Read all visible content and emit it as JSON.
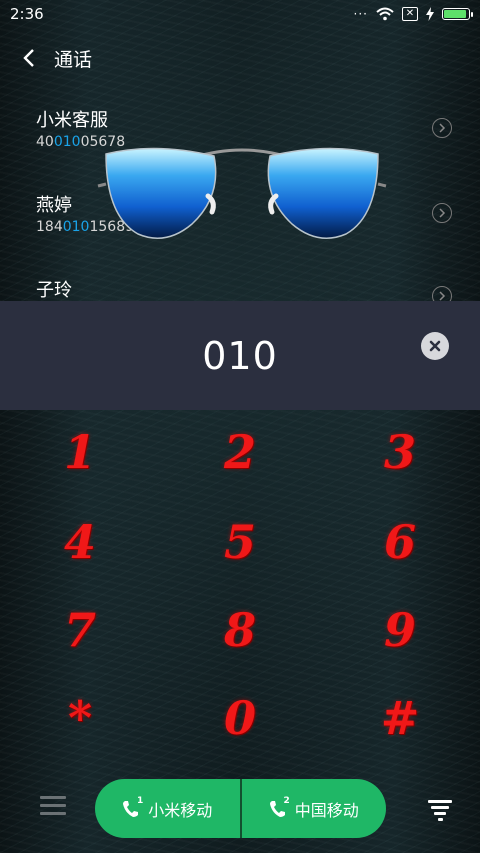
{
  "status": {
    "time": "2:36"
  },
  "header": {
    "title": "通话"
  },
  "contacts": [
    {
      "name": "小米客服",
      "num_pre": "40",
      "num_hl": "010",
      "num_post": "05678"
    },
    {
      "name": "燕婷",
      "num_pre": "184",
      "num_hl": "010",
      "num_post": "15689"
    },
    {
      "name": "子玲",
      "num_pre": "",
      "num_hl": "",
      "num_post": ""
    }
  ],
  "dial": {
    "value": "010"
  },
  "keys": [
    "1",
    "2",
    "3",
    "4",
    "5",
    "6",
    "7",
    "8",
    "9",
    "*",
    "0",
    "#"
  ],
  "bottom": {
    "sim1_label": "小米移动",
    "sim1_num": "1",
    "sim2_label": "中国移动",
    "sim2_num": "2"
  },
  "colors": {
    "highlight": "#1aa3e8",
    "call_green": "#1fb766",
    "key_red": "#f01818",
    "dial_bar": "#2b2f3f"
  },
  "icons": [
    "back-arrow-icon",
    "wifi-icon",
    "sim-none-icon",
    "charging-icon",
    "battery-icon",
    "chevron-right-icon",
    "clear-icon",
    "menu-icon",
    "phone-icon",
    "dialpad-icon"
  ]
}
